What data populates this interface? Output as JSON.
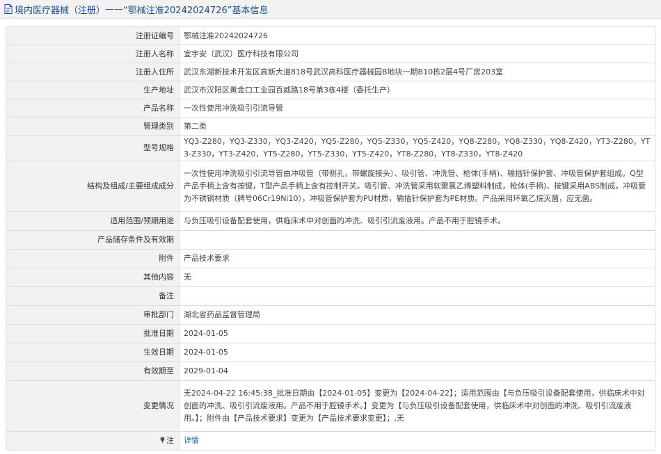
{
  "header": {
    "crumb": "境内医疗器械（注册）",
    "separator": " —— ",
    "title": "“鄂械注准20242024726”基本信息"
  },
  "rows": [
    {
      "label": "注册证编号",
      "value": "鄂械注准20242024726"
    },
    {
      "label": "注册人名称",
      "value": "宜宇安（武汉）医疗科技有限公司"
    },
    {
      "label": "注册人住所",
      "value": "武汉东湖新技术开发区高新大道818号武汉高科医疗器械园B地块一期B10栋2层4号厂房203室"
    },
    {
      "label": "生产地址",
      "value": "武汉市汉阳区黄金口工业园百威路18号第3栋4楼（委托生产）"
    },
    {
      "label": "产品名称",
      "value": "一次性使用冲洗吸引引流导管"
    },
    {
      "label": "管理类别",
      "value": "第二类"
    },
    {
      "label": "型号规格",
      "value": "YQ3-Z280，YQ3-Z330，YQ3-Z420，YQ5-Z280，YQ5-Z330，YQ5-Z420，YQ8-Z280，YQ8-Z330，YQ8-Z420，YT3-Z280，YT3-Z330，YT3-Z420，YT5-Z280，YT5-Z330，YT5-Z420，YT8-Z280，YT8-Z330，YT8-Z420"
    },
    {
      "label": "结构及组成/主要组成成分",
      "value": "一次性使用冲洗吸引引流导管由冲吸管（带侧孔，带螺旋接头）、吸引管、冲洗管、枪体(手柄)、输插针保护套、冲吸管保护套组成。Q型产品手柄上含有按键，T型产品手柄上含有控制开关。吸引管、冲洗管采用软聚氯乙烯塑料制成，枪体(手柄)、按键采用ABS制成，冲吸管为不锈钢材质（牌号06Cr19Ni10），冲吸管保护套为PU材质，输插针保护套为PE材质。产品采用环氧乙烷灭菌，应无菌。"
    },
    {
      "label": "适用范围/预期用途",
      "value": "与负压吸引设备配套使用，供临床术中对创面的冲洗、吸引引流废液用。产品不用于腔镜手术。"
    },
    {
      "label": "产品储存条件及有效期",
      "value": ""
    },
    {
      "label": "附件",
      "value": "产品技术要求"
    },
    {
      "label": "其他内容",
      "value": "无"
    },
    {
      "label": "备注",
      "value": ""
    },
    {
      "label": "审批部门",
      "value": "湖北省药品监督管理局"
    },
    {
      "label": "批准日期",
      "value": "2024-01-05"
    },
    {
      "label": "生效日期",
      "value": "2024-01-05"
    },
    {
      "label": "有效期至",
      "value": "2029-01-04"
    },
    {
      "label": "变更情况",
      "value": "无2024-04-22 16:45:38_批准日期由【2024-01-05】变更为【2024-04-22】；适用范围由【与负压吸引设备配套使用，供临床术中对创面的冲洗、吸引引流废液用。产品不用于腔镜手术。】变更为【与负压吸引设备配套使用，供临床术中对创面的冲洗、吸引引流废液用。】；附件由【产品技术要求】变更为【产品技术要求变更】；,无"
    }
  ],
  "note_row": {
    "label": "注",
    "link": "详情"
  }
}
